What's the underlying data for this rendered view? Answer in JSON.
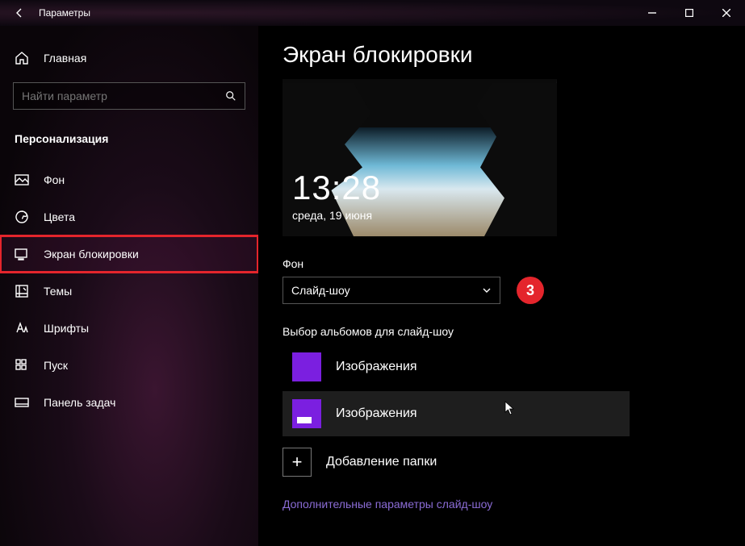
{
  "window": {
    "title": "Параметры"
  },
  "sidebar": {
    "home": "Главная",
    "search_placeholder": "Найти параметр",
    "section": "Персонализация",
    "items": [
      {
        "label": "Фон"
      },
      {
        "label": "Цвета"
      },
      {
        "label": "Экран блокировки"
      },
      {
        "label": "Темы"
      },
      {
        "label": "Шрифты"
      },
      {
        "label": "Пуск"
      },
      {
        "label": "Панель задач"
      }
    ]
  },
  "content": {
    "heading": "Экран блокировки",
    "preview": {
      "time": "13:28",
      "date": "среда, 19 июня"
    },
    "background_label": "Фон",
    "background_select": "Слайд-шоу",
    "annotation_badge": "3",
    "albums_label": "Выбор альбомов для слайд-шоу",
    "albums": [
      {
        "label": "Изображения"
      },
      {
        "label": "Изображения"
      }
    ],
    "add_folder": "Добавление папки",
    "more_link": "Дополнительные параметры слайд-шоу"
  }
}
